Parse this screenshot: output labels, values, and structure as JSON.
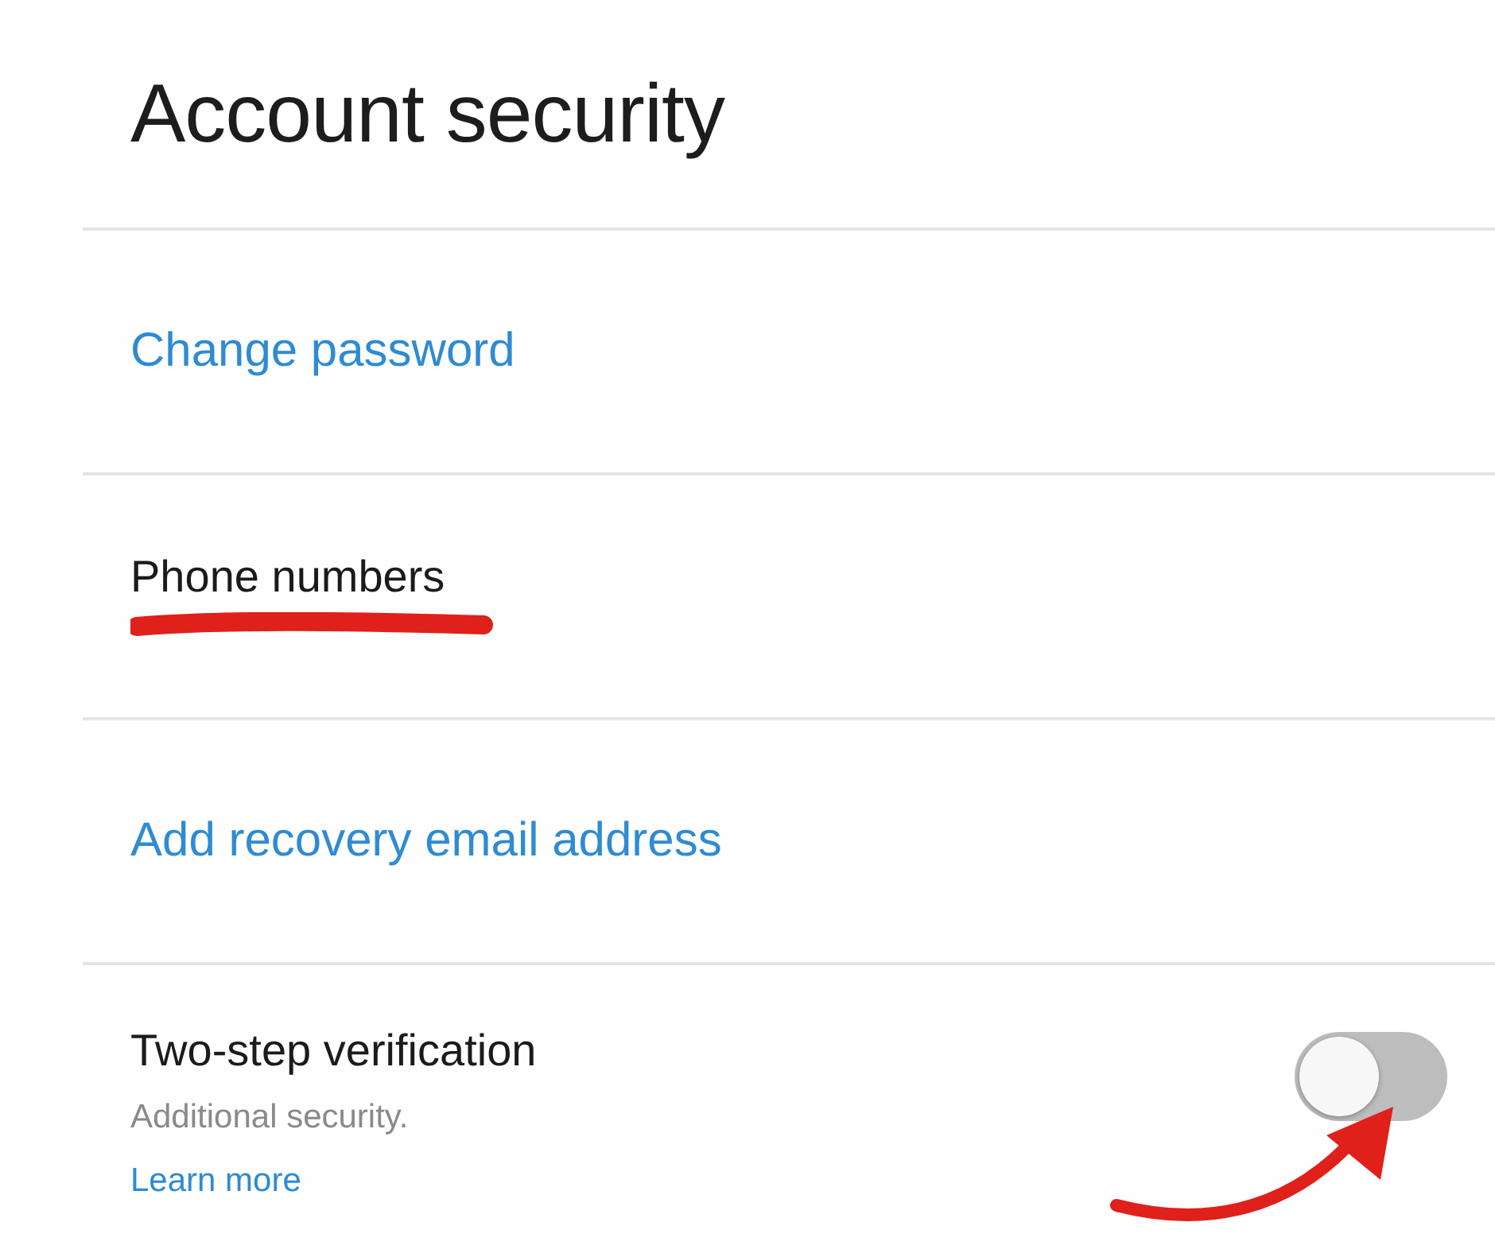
{
  "title": "Account security",
  "items": [
    {
      "kind": "link",
      "label": "Change password"
    },
    {
      "kind": "text",
      "label": "Phone numbers",
      "underlined": true
    },
    {
      "kind": "link",
      "label": "Add recovery email address"
    },
    {
      "kind": "toggle",
      "label": "Two-step verification",
      "description": "Additional security.",
      "link": "Learn more",
      "on": false,
      "arrow": true
    }
  ]
}
